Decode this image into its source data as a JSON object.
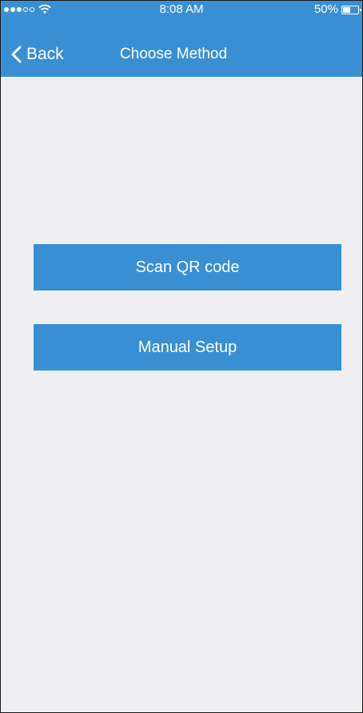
{
  "status_bar": {
    "time": "8:08 AM",
    "battery_percent": "50%",
    "battery_level": 0.5,
    "signal_bars": 3,
    "signal_total": 5
  },
  "nav": {
    "back_label": "Back",
    "title": "Choose Method"
  },
  "actions": {
    "scan_label": "Scan QR code",
    "manual_label": "Manual Setup"
  },
  "colors": {
    "accent": "#3a8fd2",
    "background": "#efeef3"
  }
}
